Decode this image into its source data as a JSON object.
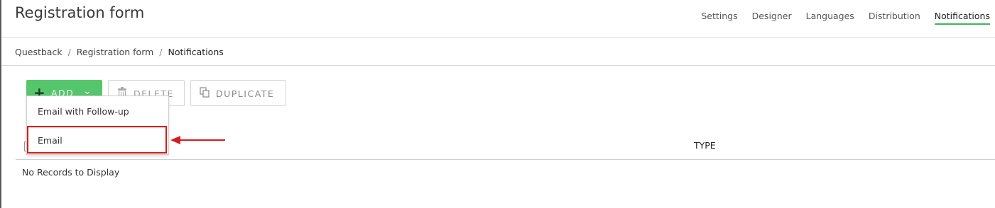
{
  "header": {
    "title": "Registration form",
    "tabs": [
      {
        "label": "Settings",
        "active": false
      },
      {
        "label": "Designer",
        "active": false
      },
      {
        "label": "Languages",
        "active": false
      },
      {
        "label": "Distribution",
        "active": false
      },
      {
        "label": "Notifications",
        "active": true
      }
    ]
  },
  "breadcrumb": {
    "items": [
      "Questback",
      "Registration form",
      "Notifications"
    ],
    "separator": "/"
  },
  "toolbar": {
    "add_label": "ADD",
    "delete_label": "DELETE",
    "duplicate_label": "DUPLICATE"
  },
  "dropdown": {
    "items": [
      "Email with Follow-up",
      "Email"
    ],
    "highlighted": "Email"
  },
  "table": {
    "column_type": "TYPE",
    "empty_message": "No Records to Display"
  },
  "colors": {
    "accent_green": "#55c66c",
    "active_tab_underline": "#3cb55a",
    "annotation_red": "#d61c1c"
  },
  "icons": {
    "add": "plus-icon",
    "add_menu": "chevron-down-icon",
    "delete": "trash-icon",
    "duplicate": "copy-icon",
    "annotation": "arrow-left-icon"
  }
}
